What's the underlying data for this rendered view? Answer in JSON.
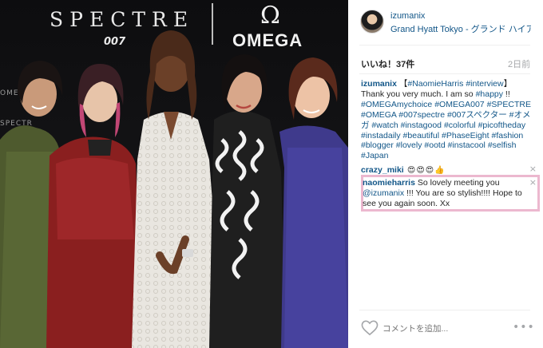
{
  "photo": {
    "brand_spectre": "SPECTRE",
    "brand_007": "007",
    "brand_omega_symbol": "Ω",
    "brand_omega": "OMEGA",
    "backdrop_text_1": "OMEGA",
    "backdrop_text_2": "SPECTR",
    "backdrop_text_3": "OM"
  },
  "post": {
    "username": "izumanix",
    "location": "Grand Hyatt Tokyo - グランド ハイアット東京",
    "likes": "いいね！37件",
    "time_ago": "2日前"
  },
  "comments": [
    {
      "user": "izumanix",
      "segments": [
        {
          "text": " 【",
          "link": false
        },
        {
          "text": "#NaomieHarris",
          "link": true
        },
        {
          "text": " ",
          "link": false
        },
        {
          "text": "#interview",
          "link": true
        },
        {
          "text": "】 Thank you very much. I am so ",
          "link": false
        },
        {
          "text": "#happy",
          "link": true
        },
        {
          "text": " !! ",
          "link": false
        },
        {
          "text": "#OMEGAmychoice",
          "link": true
        },
        {
          "text": " ",
          "link": false
        },
        {
          "text": "#OMEGA007",
          "link": true
        },
        {
          "text": " ",
          "link": false
        },
        {
          "text": "#SPECTRE",
          "link": true
        },
        {
          "text": " ",
          "link": false
        },
        {
          "text": "#OMEGA",
          "link": true
        },
        {
          "text": " ",
          "link": false
        },
        {
          "text": "#007spectre",
          "link": true
        },
        {
          "text": " ",
          "link": false
        },
        {
          "text": "#007スペクター",
          "link": true
        },
        {
          "text": " ",
          "link": false
        },
        {
          "text": "#オメガ",
          "link": true
        },
        {
          "text": " ",
          "link": false
        },
        {
          "text": "#watch",
          "link": true
        },
        {
          "text": " ",
          "link": false
        },
        {
          "text": "#instagood",
          "link": true
        },
        {
          "text": " ",
          "link": false
        },
        {
          "text": "#colorful",
          "link": true
        },
        {
          "text": " ",
          "link": false
        },
        {
          "text": "#picoftheday",
          "link": true
        },
        {
          "text": " ",
          "link": false
        },
        {
          "text": "#instadaily",
          "link": true
        },
        {
          "text": " ",
          "link": false
        },
        {
          "text": "#beautiful",
          "link": true
        },
        {
          "text": " ",
          "link": false
        },
        {
          "text": "#PhaseEight",
          "link": true
        },
        {
          "text": " ",
          "link": false
        },
        {
          "text": "#fashion",
          "link": true
        },
        {
          "text": " ",
          "link": false
        },
        {
          "text": "#blogger",
          "link": true
        },
        {
          "text": " ",
          "link": false
        },
        {
          "text": "#lovely",
          "link": true
        },
        {
          "text": " ",
          "link": false
        },
        {
          "text": "#ootd",
          "link": true
        },
        {
          "text": " ",
          "link": false
        },
        {
          "text": "#instacool",
          "link": true
        },
        {
          "text": " ",
          "link": false
        },
        {
          "text": "#selfish",
          "link": true
        },
        {
          "text": " ",
          "link": false
        },
        {
          "text": "#Japan",
          "link": true
        }
      ]
    },
    {
      "user": "crazy_miki",
      "text": " 😍😍😍👍",
      "close": "×"
    },
    {
      "user": "naomieharris",
      "text_before": " So lovely meeting you ",
      "mention": "@izumanix",
      "text_after": " !!! You are so stylish!!!! Hope to see you again soon. Xx",
      "close": "×"
    }
  ],
  "footer": {
    "comment_placeholder": "コメントを追加...",
    "more": "•••"
  },
  "colors": {
    "link": "#125688",
    "muted": "#a5a7aa",
    "highlight_border": "#ecb8cf"
  }
}
